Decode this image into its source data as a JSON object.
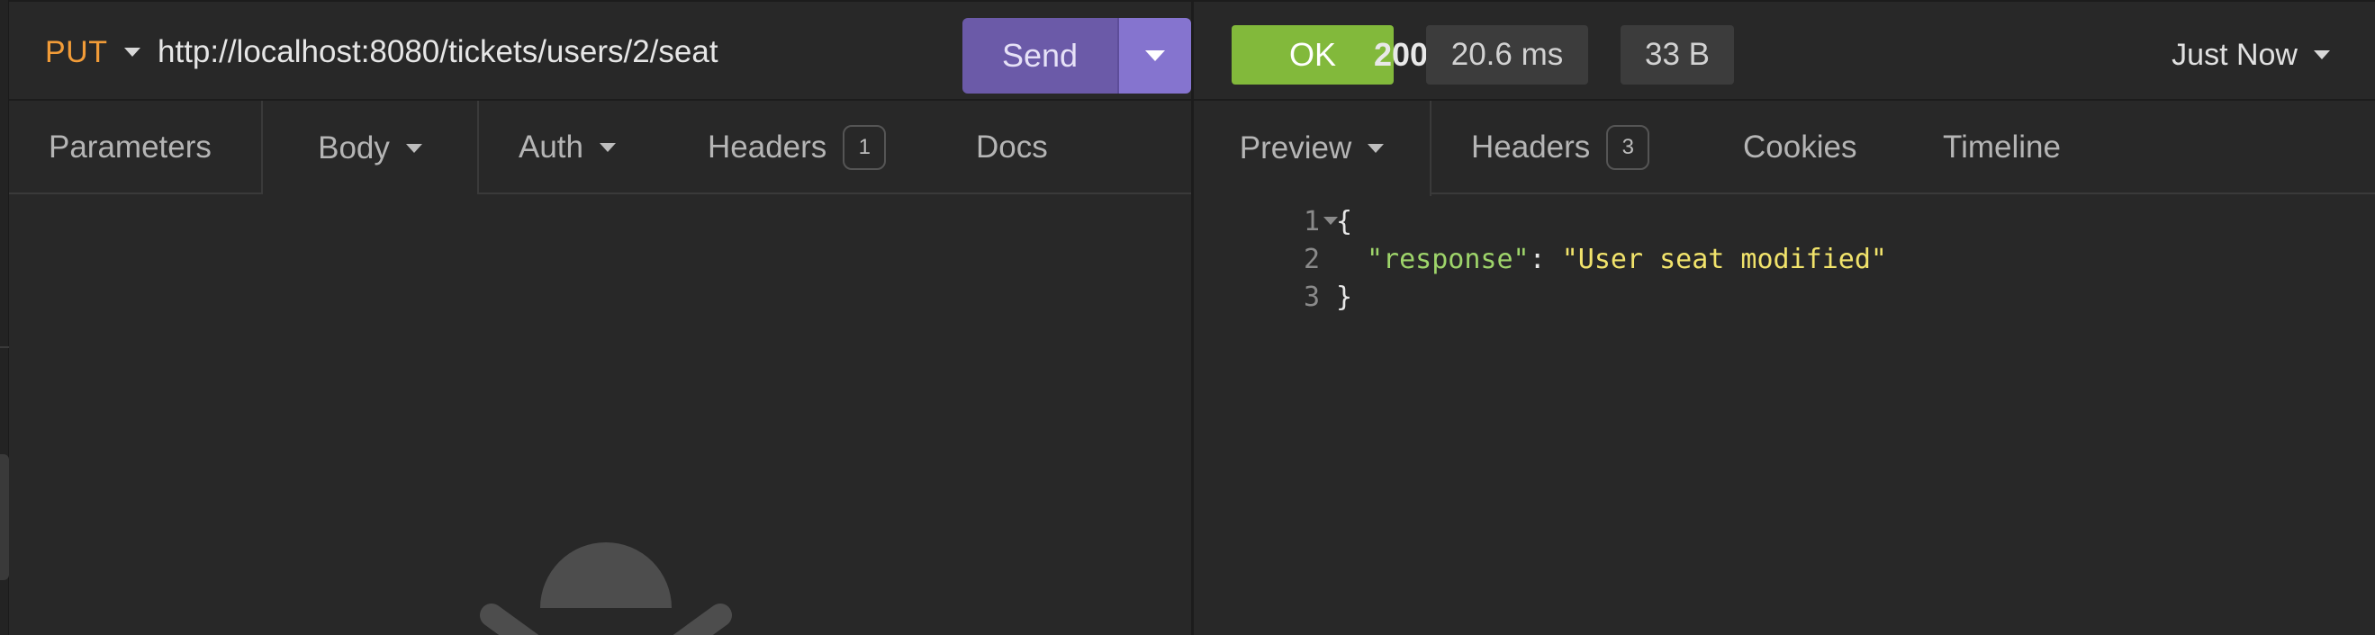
{
  "request": {
    "method": "PUT",
    "url": "http://localhost:8080/tickets/users/2/seat",
    "send_label": "Send",
    "tabs": [
      {
        "label": "Parameters"
      },
      {
        "label": "Body"
      },
      {
        "label": "Auth"
      },
      {
        "label": "Headers",
        "count": "1"
      },
      {
        "label": "Docs"
      }
    ],
    "active_tab": "Body"
  },
  "response": {
    "status_code": "200",
    "status_text": "OK",
    "status_color": "#82b93b",
    "time": "20.6 ms",
    "size": "33 B",
    "history_label": "Just Now",
    "tabs": [
      {
        "label": "Preview"
      },
      {
        "label": "Headers",
        "count": "3"
      },
      {
        "label": "Cookies"
      },
      {
        "label": "Timeline"
      }
    ],
    "active_tab": "Preview",
    "body_lines": [
      {
        "num": "1",
        "open": "{"
      },
      {
        "num": "2",
        "key": "\"response\"",
        "sep": ": ",
        "value": "\"User seat modified\""
      },
      {
        "num": "3",
        "close": "}"
      }
    ]
  },
  "colors": {
    "accent": "#8574cf",
    "send": "#6b5aa8",
    "method": "#f29c38",
    "json_key": "#9ed46a",
    "json_string": "#f1e36b"
  },
  "icons": [
    "chevron-down-icon",
    "empty-body-illustration"
  ]
}
